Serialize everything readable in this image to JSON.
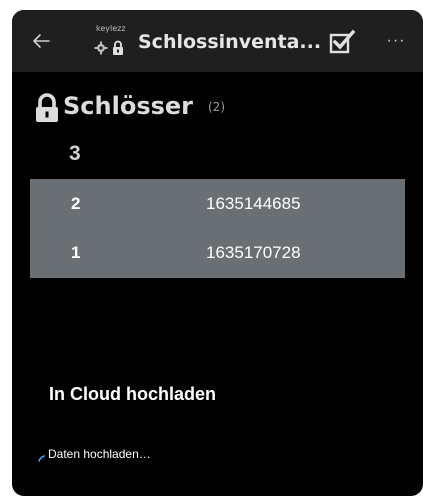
{
  "appbar": {
    "brand": "keylezz",
    "title": "Schlossinventa...",
    "back_icon": "arrow-left-icon",
    "check_icon": "checkbox-checked-icon",
    "more_icon": "more-horizontal-icon",
    "more_glyph": "···"
  },
  "section": {
    "title": "Schlösser",
    "count": "(2)",
    "icon": "lock-icon"
  },
  "group": {
    "number": "3"
  },
  "table": {
    "rows": [
      {
        "num": "2",
        "id": "1635144685"
      },
      {
        "num": "1",
        "id": "1635170728"
      }
    ]
  },
  "upload": {
    "title": "In Cloud hochladen",
    "progress_text": "Daten hochladen…"
  },
  "colors": {
    "window_bg": "#000000",
    "appbar_bg": "#1f1f1f",
    "table_bg": "#6a6f73",
    "spinner": "#3aa0ff"
  }
}
